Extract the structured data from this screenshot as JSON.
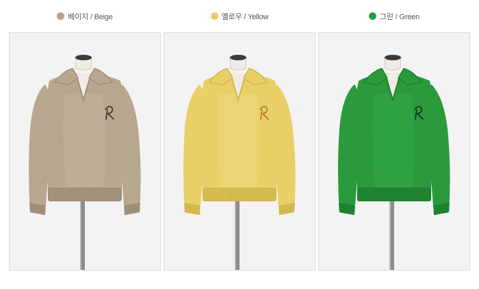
{
  "products": [
    {
      "color_name": "베이지 / Beige",
      "swatch": "#b3a38d",
      "sweater": "#b8a78f",
      "shade": "#9f8f78",
      "light": "#cbbca6",
      "logo": "#3a2f28"
    },
    {
      "color_name": "옐로우 / Yellow",
      "swatch": "#e9d069",
      "sweater": "#e8cf66",
      "shade": "#d2b74f",
      "light": "#f1de86",
      "logo": "#a8762a"
    },
    {
      "color_name": "그린 / Green",
      "swatch": "#2e9a45",
      "sweater": "#2a9a3d",
      "shade": "#1f8030",
      "light": "#3fb150",
      "logo": "#1d2b1d"
    }
  ]
}
